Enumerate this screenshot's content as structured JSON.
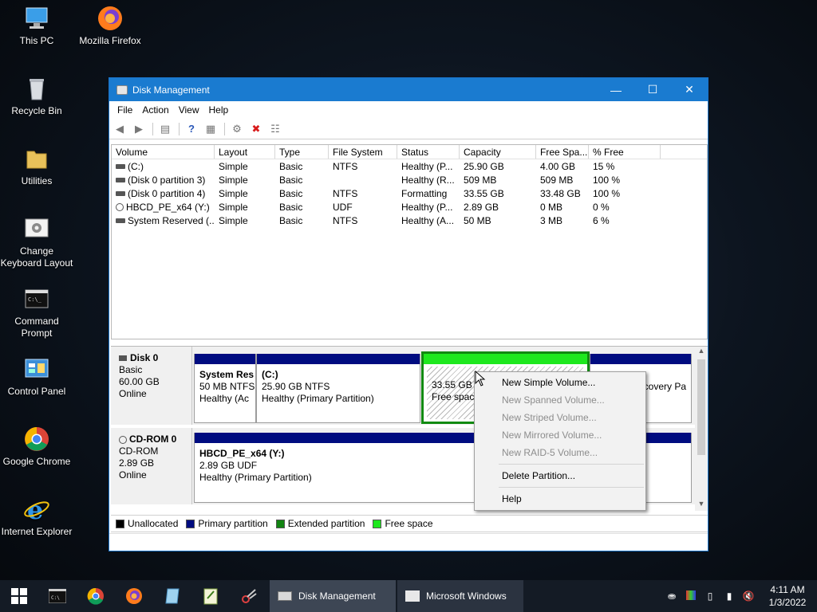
{
  "desktop": {
    "icons": [
      {
        "label_lines": [
          "This PC"
        ],
        "icon": "computer-icon"
      },
      {
        "label_lines": [
          "Mozilla Firefox"
        ],
        "icon": "firefox-icon"
      },
      {
        "label_lines": [
          "Recycle Bin"
        ],
        "icon": "recycle-bin-icon"
      },
      {
        "label_lines": [
          "Utilities"
        ],
        "icon": "folder-icon"
      },
      {
        "label_lines": [
          "Change",
          "Keyboard Layout"
        ],
        "icon": "keyboard-settings-icon"
      },
      {
        "label_lines": [
          "Command",
          "Prompt"
        ],
        "icon": "command-prompt-icon"
      },
      {
        "label_lines": [
          "Control Panel"
        ],
        "icon": "control-panel-icon"
      },
      {
        "label_lines": [
          "Google Chrome"
        ],
        "icon": "chrome-icon"
      },
      {
        "label_lines": [
          "Internet Explorer"
        ],
        "icon": "internet-explorer-icon"
      }
    ]
  },
  "window": {
    "title": "Disk Management",
    "menu": [
      "File",
      "Action",
      "View",
      "Help"
    ],
    "columns": [
      "Volume",
      "Layout",
      "Type",
      "File System",
      "Status",
      "Capacity",
      "Free Spa...",
      "% Free"
    ],
    "volumes": [
      {
        "volume": "(C:)",
        "layout": "Simple",
        "type": "Basic",
        "fs": "NTFS",
        "status": "Healthy (P...",
        "capacity": "25.90 GB",
        "free": "4.00 GB",
        "pct": "15 %",
        "icon": "drive-icon"
      },
      {
        "volume": "(Disk 0 partition 3)",
        "layout": "Simple",
        "type": "Basic",
        "fs": "",
        "status": "Healthy (R...",
        "capacity": "509 MB",
        "free": "509 MB",
        "pct": "100 %",
        "icon": "drive-icon"
      },
      {
        "volume": "(Disk 0 partition 4)",
        "layout": "Simple",
        "type": "Basic",
        "fs": "NTFS",
        "status": "Formatting",
        "capacity": "33.55 GB",
        "free": "33.48 GB",
        "pct": "100 %",
        "icon": "drive-icon"
      },
      {
        "volume": "HBCD_PE_x64 (Y:)",
        "layout": "Simple",
        "type": "Basic",
        "fs": "UDF",
        "status": "Healthy (P...",
        "capacity": "2.89 GB",
        "free": "0 MB",
        "pct": "0 %",
        "icon": "cd-drive-icon"
      },
      {
        "volume": "System Reserved (...",
        "layout": "Simple",
        "type": "Basic",
        "fs": "NTFS",
        "status": "Healthy (A...",
        "capacity": "50 MB",
        "free": "3 MB",
        "pct": "6 %",
        "icon": "drive-icon"
      }
    ],
    "disks": {
      "disk0": {
        "name": "Disk 0",
        "type": "Basic",
        "size": "60.00 GB",
        "state": "Online"
      },
      "cdrom0": {
        "name": "CD-ROM 0",
        "type": "CD-ROM",
        "size": "2.89 GB",
        "state": "Online"
      }
    },
    "partitions": {
      "sysres": {
        "name": "System Res",
        "size": "50 MB NTFS",
        "status": "Healthy (Ac"
      },
      "c": {
        "name": "(C:)",
        "size": "25.90 GB NTFS",
        "status": "Healthy (Primary Partition)"
      },
      "p4": {
        "size": "33.55 GB",
        "status": "Free space"
      },
      "recovery": {
        "status": "covery Pa"
      },
      "hbcd": {
        "name": "HBCD_PE_x64  (Y:)",
        "size": "2.89 GB UDF",
        "status": "Healthy (Primary Partition)"
      }
    },
    "legend": [
      {
        "label": "Unallocated",
        "color": "#000000"
      },
      {
        "label": "Primary partition",
        "color": "#000c80"
      },
      {
        "label": "Extended partition",
        "color": "#128412"
      },
      {
        "label": "Free space",
        "color": "#1ee81e"
      }
    ]
  },
  "context_menu": {
    "items": [
      {
        "label": "New Simple Volume...",
        "enabled": true
      },
      {
        "label": "New Spanned Volume...",
        "enabled": false
      },
      {
        "label": "New Striped Volume...",
        "enabled": false
      },
      {
        "label": "New Mirrored Volume...",
        "enabled": false
      },
      {
        "label": "New RAID-5 Volume...",
        "enabled": false
      },
      {
        "label": "Delete Partition...",
        "enabled": true
      },
      {
        "label": "Help",
        "enabled": true
      }
    ]
  },
  "taskbar": {
    "tasks": [
      {
        "label": "Disk Management",
        "icon": "disk-management-icon"
      },
      {
        "label": "Microsoft Windows",
        "icon": "window-list-icon"
      }
    ],
    "clock": {
      "time": "4:11 AM",
      "date": "1/3/2022"
    }
  }
}
